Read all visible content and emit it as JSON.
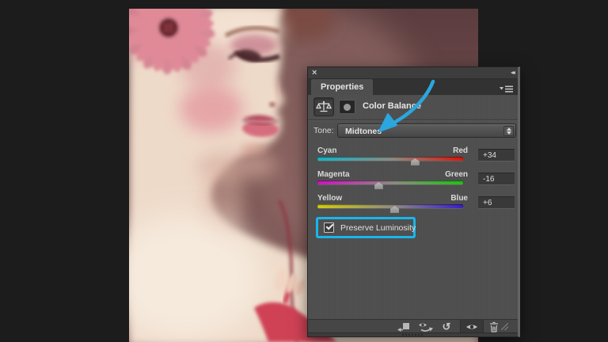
{
  "window": {
    "workspace_bg": "#1c1c1c"
  },
  "panel": {
    "close_glyph": "×",
    "collapse_glyph": "◂◂",
    "tab_label": "Properties",
    "title": "Color Balance",
    "tone": {
      "label": "Tone:",
      "value": "Midtones"
    },
    "sliders": [
      {
        "left_label": "Cyan",
        "right_label": "Red",
        "value": "+34",
        "amount": 34,
        "color_left": "#12b6c9",
        "color_mid": "#8e8a82",
        "color_right": "#e01408"
      },
      {
        "left_label": "Magenta",
        "right_label": "Green",
        "value": "-16",
        "amount": -16,
        "color_left": "#cf14c2",
        "color_mid": "#8e8a82",
        "color_right": "#1fc316"
      },
      {
        "left_label": "Yellow",
        "right_label": "Blue",
        "value": "+6",
        "amount": 6,
        "color_left": "#d3cb12",
        "color_mid": "#8e8a82",
        "color_right": "#3a1fce"
      }
    ],
    "preserve_label": "Preserve Luminosity",
    "preserve_checked": true,
    "footer": {
      "reset_glyph": "↺"
    }
  },
  "annotations": {
    "arrow_color": "#2ba6de",
    "highlight_color": "#18b6ec"
  },
  "colors": {
    "workspace_bg": "#1c1c1c",
    "panel_bg": "#4e4e4e",
    "top_strip": "#3d3d3d",
    "tab_bar": "#323232",
    "value_box": "#393939",
    "footer_bg": "#464646"
  }
}
